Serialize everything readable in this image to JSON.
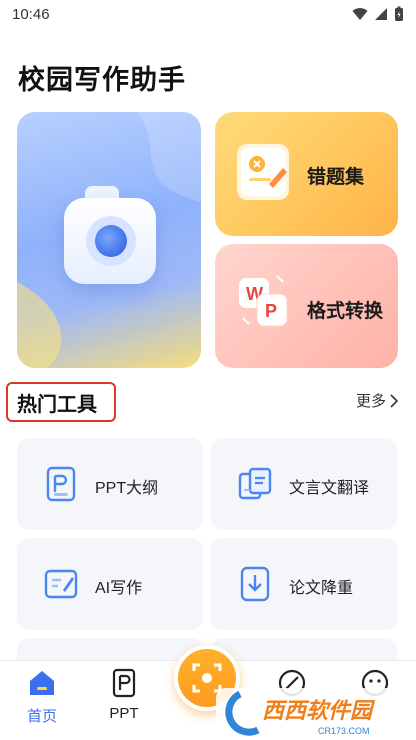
{
  "status_bar": {
    "time": "10:46"
  },
  "app": {
    "title": "校园写作助手"
  },
  "feature_cards": {
    "mistakes": {
      "label": "错题集"
    },
    "convert": {
      "label": "格式转换"
    }
  },
  "hot_tools": {
    "title": "热门工具",
    "more_label": "更多",
    "items": [
      {
        "label": "PPT大纲",
        "icon": "ppt-outline-icon"
      },
      {
        "label": "文言文翻译",
        "icon": "translate-icon"
      },
      {
        "label": "AI写作",
        "icon": "ai-write-icon"
      },
      {
        "label": "论文降重",
        "icon": "download-doc-icon"
      }
    ]
  },
  "tab_bar": {
    "items": [
      {
        "label": "首页",
        "icon": "home-icon",
        "active": true
      },
      {
        "label": "PPT",
        "icon": "ppt-icon",
        "active": false
      },
      {
        "label": "",
        "icon": "scan-icon",
        "active": false
      },
      {
        "label": "",
        "icon": "compass-icon",
        "active": false
      },
      {
        "label": "",
        "icon": "profile-icon",
        "active": false
      }
    ]
  },
  "watermark": {
    "text": "西西软件园",
    "subtext": "CR173.COM"
  },
  "colors": {
    "accent": "#3b6ff0",
    "fab": "#ff9a1e",
    "highlight_border": "#d63a2c"
  }
}
